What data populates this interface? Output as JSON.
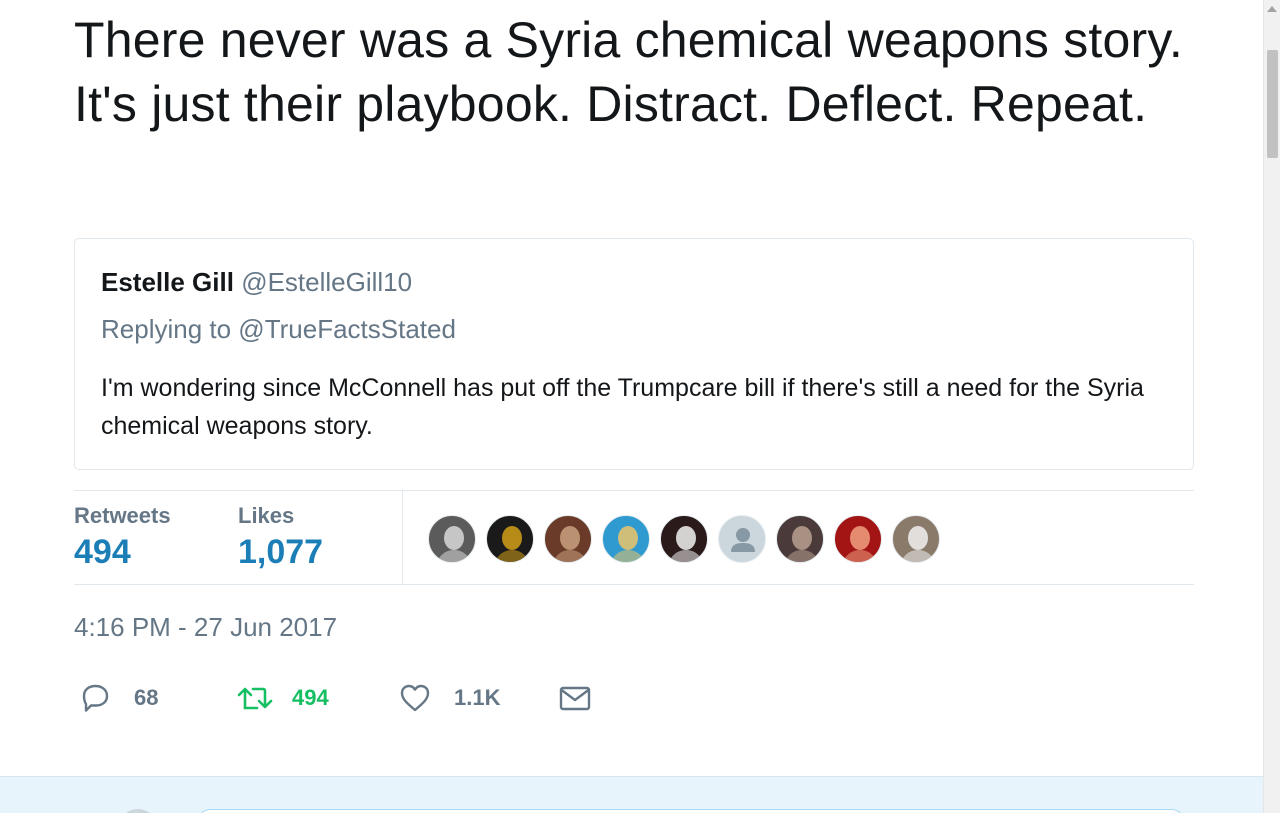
{
  "tweet": {
    "text": "There never was a Syria chemical weapons story. It's just their playbook. Distract. Deflect. Repeat."
  },
  "quoted_tweet": {
    "name": "Estelle Gill",
    "handle": "@EstelleGill10",
    "replying_to": "Replying to @TrueFactsStated",
    "body": "I'm wondering since McConnell has put off the Trumpcare bill if there's still a need for the Syria chemical weapons story."
  },
  "stats": {
    "retweets_label": "Retweets",
    "retweets_value": "494",
    "likes_label": "Likes",
    "likes_value": "1,077"
  },
  "timestamp": "4:16 PM - 27 Jun 2017",
  "actions": {
    "reply_count": "68",
    "retweet_count": "494",
    "like_count": "1.1K",
    "colors": {
      "retweet": "#17bf63",
      "muted": "#657786"
    }
  },
  "avatars": [
    {
      "icon": "avatar-photo",
      "bg": "#5b5b5b",
      "accent": "#d9d9d9"
    },
    {
      "icon": "avatar-photo",
      "bg": "#1a1a1a",
      "accent": "#d4a017"
    },
    {
      "icon": "avatar-photo",
      "bg": "#6b3b2a",
      "accent": "#c9a27e"
    },
    {
      "icon": "avatar-photo",
      "bg": "#2e9ad0",
      "accent": "#e9c46a"
    },
    {
      "icon": "avatar-photo",
      "bg": "#2a1a1a",
      "accent": "#f2f2f2"
    },
    {
      "icon": "avatar-default",
      "bg": "#ccd6dd",
      "accent": "#8899a6"
    },
    {
      "icon": "avatar-photo",
      "bg": "#4a3a3a",
      "accent": "#b8a090"
    },
    {
      "icon": "avatar-photo",
      "bg": "#a31515",
      "accent": "#f0a080"
    },
    {
      "icon": "avatar-photo",
      "bg": "#8a7a6a",
      "accent": "#f0f0f0"
    }
  ]
}
